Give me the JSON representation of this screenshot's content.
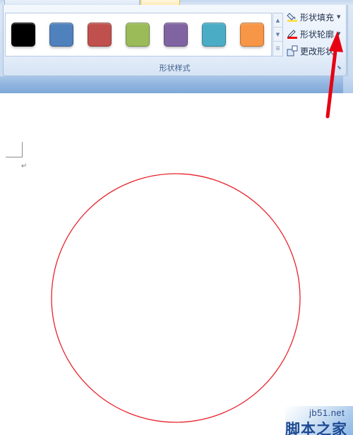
{
  "ribbon": {
    "group_label": "形状样式",
    "gallery": {
      "swatches": [
        {
          "name": "black",
          "color": "#000000"
        },
        {
          "name": "blue",
          "color": "#4f81bd"
        },
        {
          "name": "red",
          "color": "#c0504d"
        },
        {
          "name": "green",
          "color": "#9bbb59"
        },
        {
          "name": "purple",
          "color": "#8064a2"
        },
        {
          "name": "aqua",
          "color": "#4bacc6"
        },
        {
          "name": "orange",
          "color": "#f79646"
        }
      ],
      "scroll_icons": [
        "scroll-up-icon",
        "scroll-down-icon",
        "more-icon"
      ]
    },
    "commands": {
      "shape_fill": {
        "label": "形状填充",
        "icon": "paint-bucket-icon",
        "dropdown": "chevron-down-icon"
      },
      "shape_outline": {
        "label": "形状轮廓",
        "icon": "pencil-outline-icon",
        "dropdown": "chevron-down-icon",
        "outline_color": "#ff0000"
      },
      "change_shape": {
        "label": "更改形状",
        "icon": "change-shape-icon"
      }
    },
    "launcher_icon": "dialog-launcher-icon"
  },
  "document": {
    "paragraph_mark": "↵",
    "shape": {
      "type": "circle",
      "outline_color": "#e8222a",
      "fill": "none"
    }
  },
  "annotation": {
    "arrow_color": "#e60012"
  },
  "watermark": {
    "site": "jb51.net",
    "name": "脚本之家"
  }
}
